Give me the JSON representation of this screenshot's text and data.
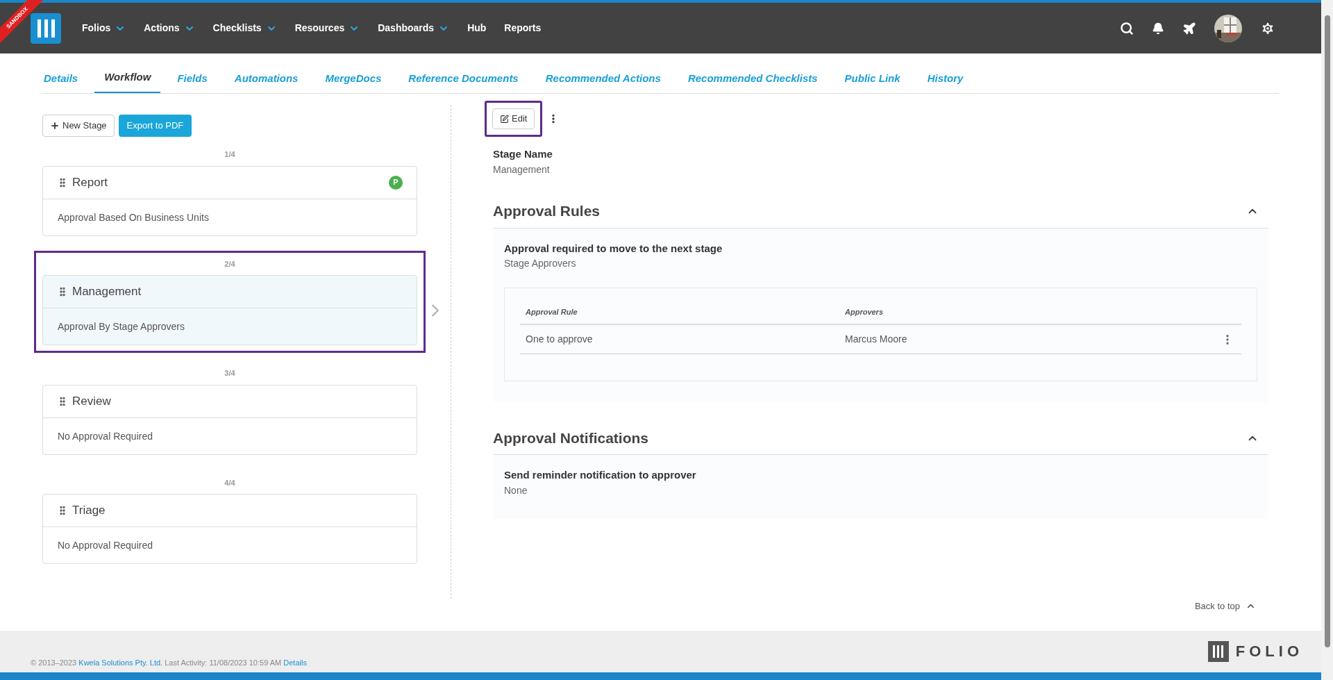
{
  "sandbox": "SANDBOX",
  "nav": [
    {
      "label": "Folios",
      "dropdown": true
    },
    {
      "label": "Actions",
      "dropdown": true
    },
    {
      "label": "Checklists",
      "dropdown": true
    },
    {
      "label": "Resources",
      "dropdown": true
    },
    {
      "label": "Dashboards",
      "dropdown": true
    },
    {
      "label": "Hub",
      "dropdown": false
    },
    {
      "label": "Reports",
      "dropdown": false
    }
  ],
  "tabs": [
    {
      "label": "Details",
      "selected": false
    },
    {
      "label": "Workflow",
      "selected": true
    },
    {
      "label": "Fields",
      "selected": false
    },
    {
      "label": "Automations",
      "selected": false
    },
    {
      "label": "MergeDocs",
      "selected": false
    },
    {
      "label": "Reference Documents",
      "selected": false
    },
    {
      "label": "Recommended Actions",
      "selected": false
    },
    {
      "label": "Recommended Checklists",
      "selected": false
    },
    {
      "label": "Public Link",
      "selected": false
    },
    {
      "label": "History",
      "selected": false
    }
  ],
  "toolbar": {
    "new_stage": "New Stage",
    "export": "Export to PDF"
  },
  "stages": [
    {
      "counter": "1/4",
      "name": "Report",
      "approval": "Approval Based On Business Units",
      "badge": "P",
      "selected": false
    },
    {
      "counter": "2/4",
      "name": "Management",
      "approval": "Approval By Stage Approvers",
      "selected": true
    },
    {
      "counter": "3/4",
      "name": "Review",
      "approval": "No Approval Required",
      "selected": false
    },
    {
      "counter": "4/4",
      "name": "Triage",
      "approval": "No Approval Required",
      "selected": false
    }
  ],
  "detail": {
    "edit": {
      "label": "Edit",
      "highlighted": true
    },
    "stage_name_label": "Stage Name",
    "stage_name": "Management",
    "sections": [
      {
        "title": "Approval Rules",
        "expanded": true,
        "field_label": "Approval required to move to the next stage",
        "field_value": "Stage Approvers",
        "table": {
          "columns": [
            "Approval Rule",
            "Approvers"
          ],
          "rows": [
            [
              "One to approve",
              "Marcus Moore"
            ]
          ]
        }
      },
      {
        "title": "Approval Notifications",
        "expanded": true,
        "field_label": "Send reminder notification to approver",
        "field_value": "None"
      }
    ]
  },
  "back_to_top": "Back to top",
  "footer": {
    "copyright": "© 2013–2023",
    "company": "Kwela Solutions Pty. Ltd.",
    "activity": "Last Activity: 11/08/2023 10:59 AM",
    "details": "Details",
    "logo": "FOLIO"
  }
}
